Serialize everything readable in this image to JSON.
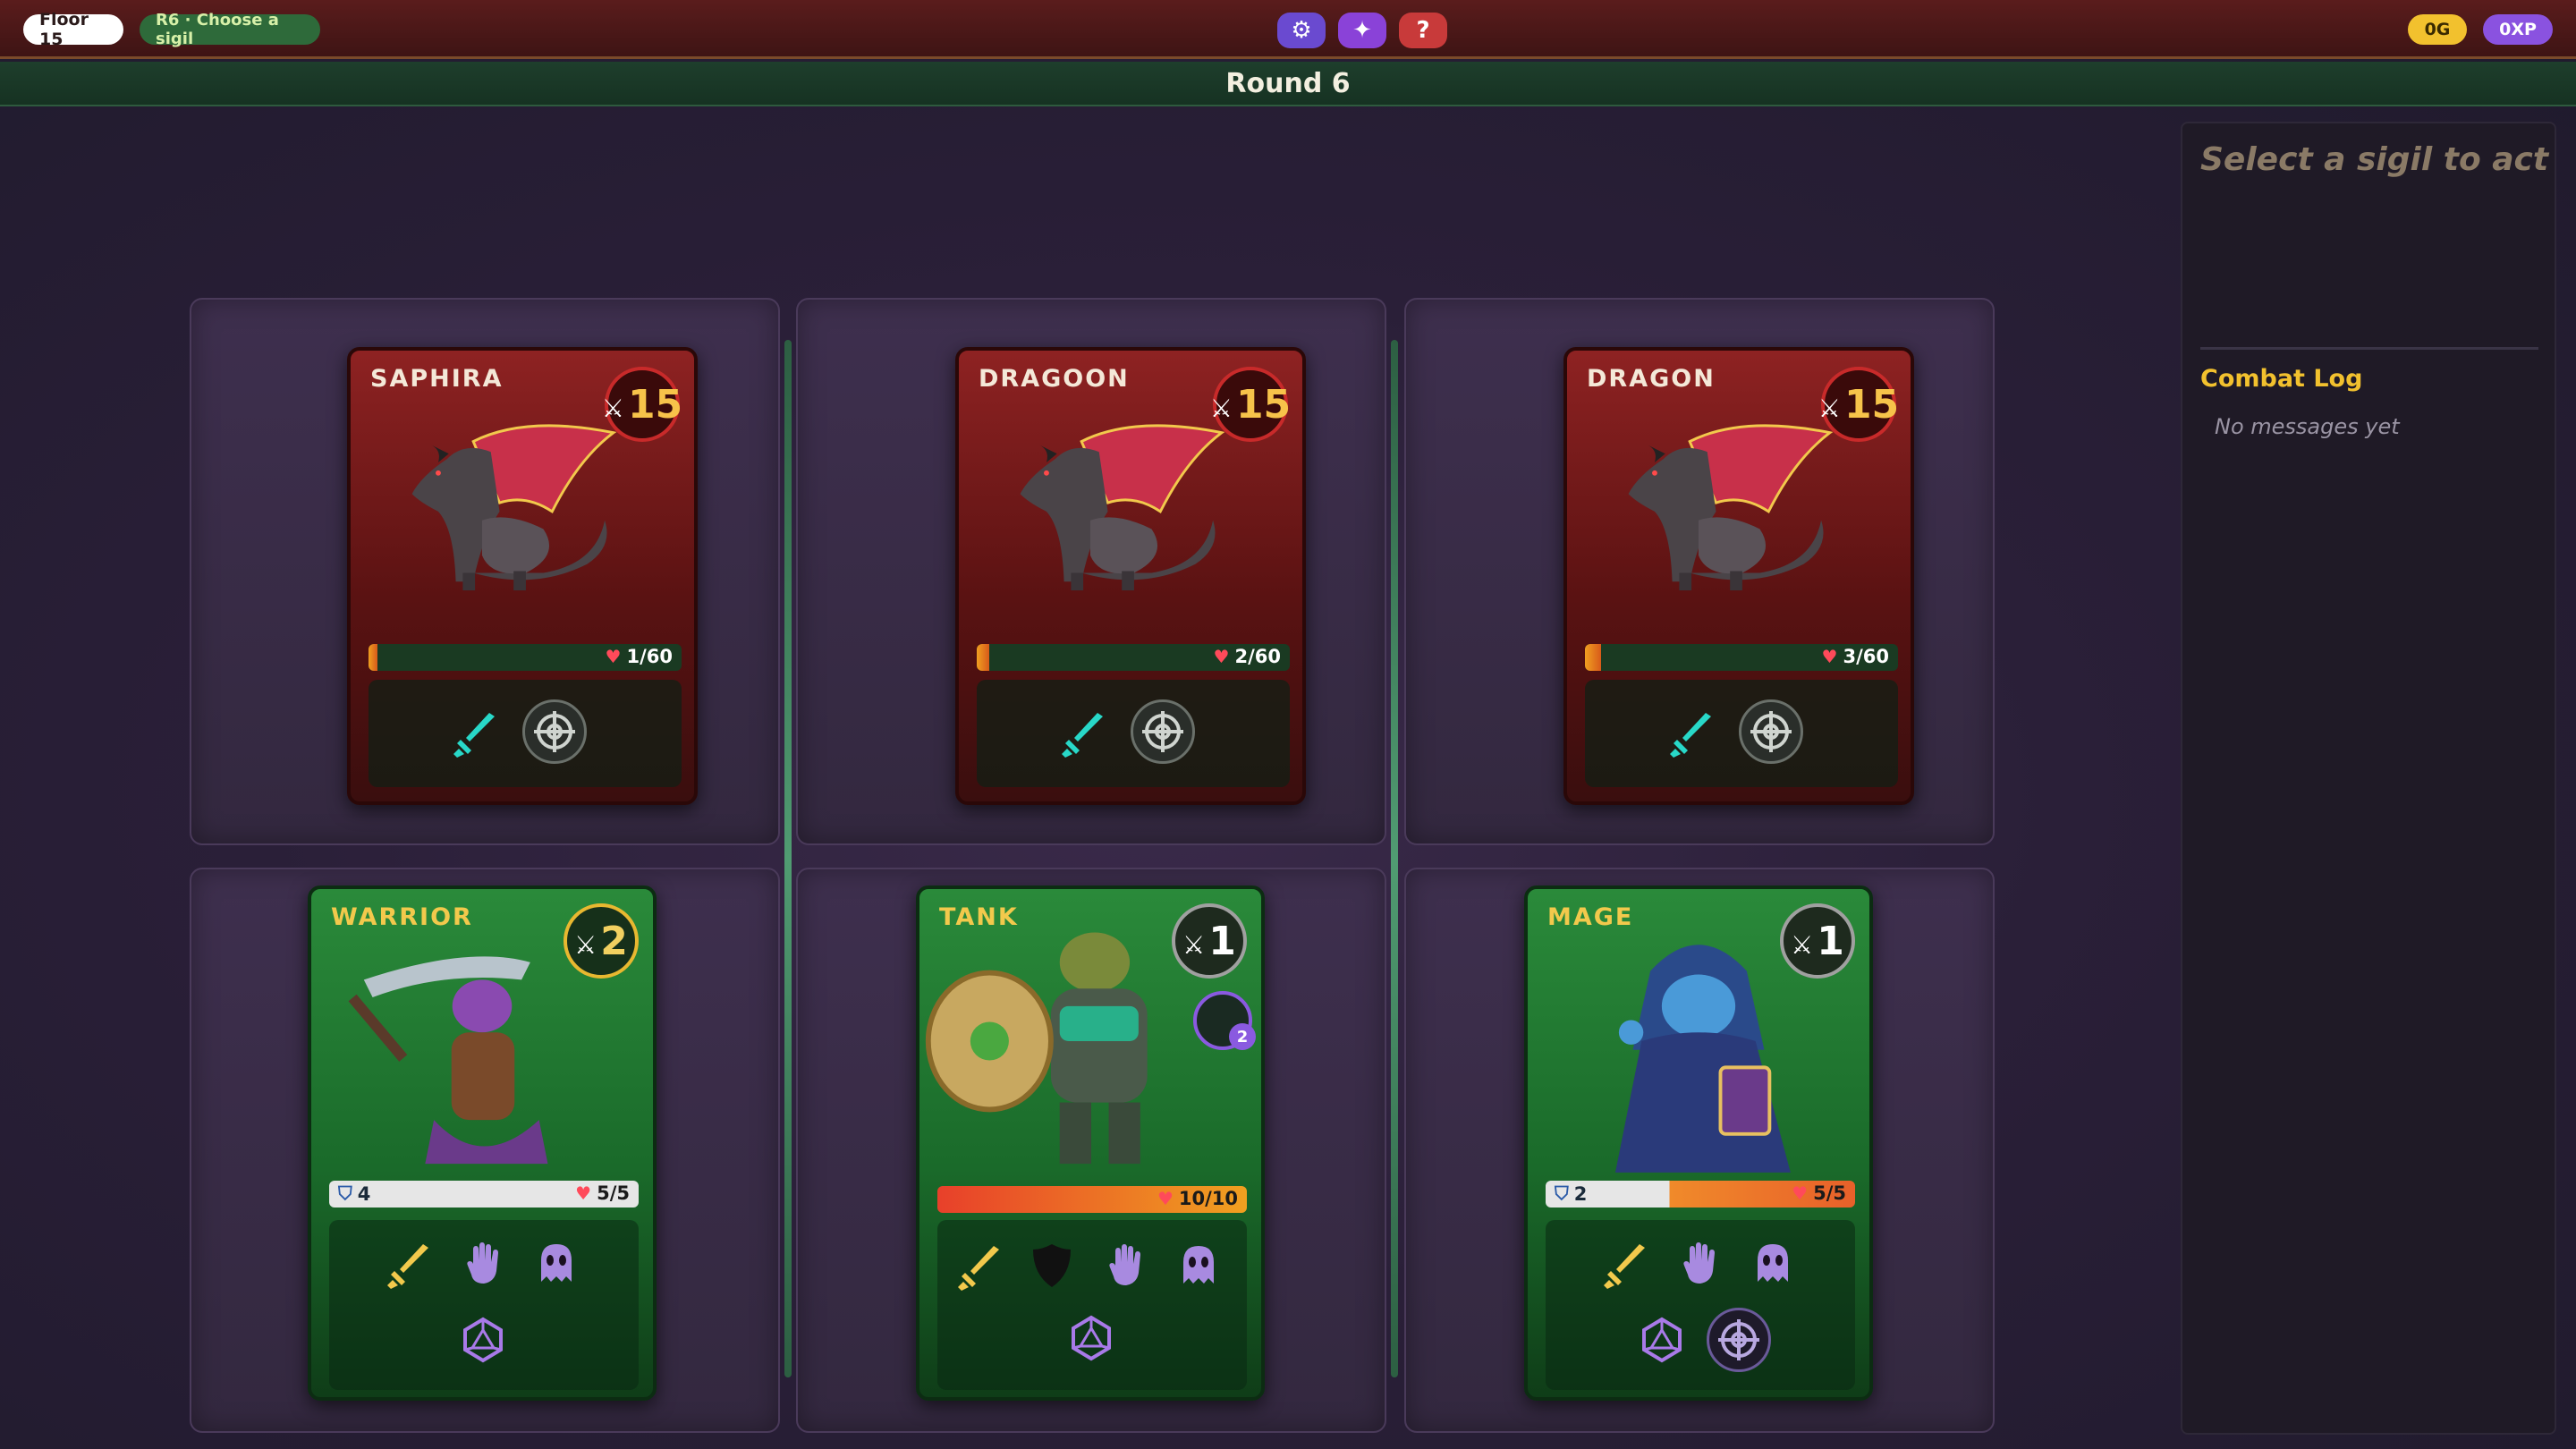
{
  "topbar": {
    "floor_label": "Floor 15",
    "stage_label": "R6 · Choose a sigil",
    "gold_label": "0G",
    "xp_label": "0XP",
    "settings_icon": "gear-icon",
    "spark_icon": "sparkle-icon",
    "help_label": "?"
  },
  "round": {
    "label": "Round 6"
  },
  "enemies": [
    {
      "name": "SAPHIRA",
      "attack": "15",
      "hp_text": "1/60",
      "hp_fraction": 0.0167,
      "abilities": [
        "sword",
        "crosshair"
      ]
    },
    {
      "name": "DRAGOON",
      "attack": "15",
      "hp_text": "2/60",
      "hp_fraction": 0.033,
      "abilities": [
        "sword",
        "crosshair"
      ]
    },
    {
      "name": "DRAGON",
      "attack": "15",
      "hp_text": "3/60",
      "hp_fraction": 0.05,
      "abilities": [
        "sword",
        "crosshair"
      ]
    }
  ],
  "allies": [
    {
      "name": "WARRIOR",
      "attack": "2",
      "shield": "4",
      "hp_text": "5/5",
      "abilities": [
        "sword",
        "hand",
        "ghost"
      ],
      "row2": [
        "d20"
      ]
    },
    {
      "name": "TANK",
      "attack": "1",
      "shield": "",
      "hp_text": "10/10",
      "status_count": "2",
      "abilities": [
        "sword",
        "shield",
        "hand",
        "ghost"
      ],
      "row2": [
        "d20"
      ]
    },
    {
      "name": "MAGE",
      "attack": "1",
      "shield": "2",
      "hp_text": "5/5",
      "abilities": [
        "sword",
        "hand",
        "ghost"
      ],
      "row2": [
        "d20",
        "crosshair"
      ]
    }
  ],
  "sidepanel": {
    "prompt": "Select a sigil to act",
    "log_title": "Combat Log",
    "log_empty": "No messages yet"
  },
  "colors": {
    "enemy_card": "#8e2222",
    "ally_card": "#2a8a3a",
    "gold": "#f2c12e",
    "xp": "#8a52e0"
  }
}
